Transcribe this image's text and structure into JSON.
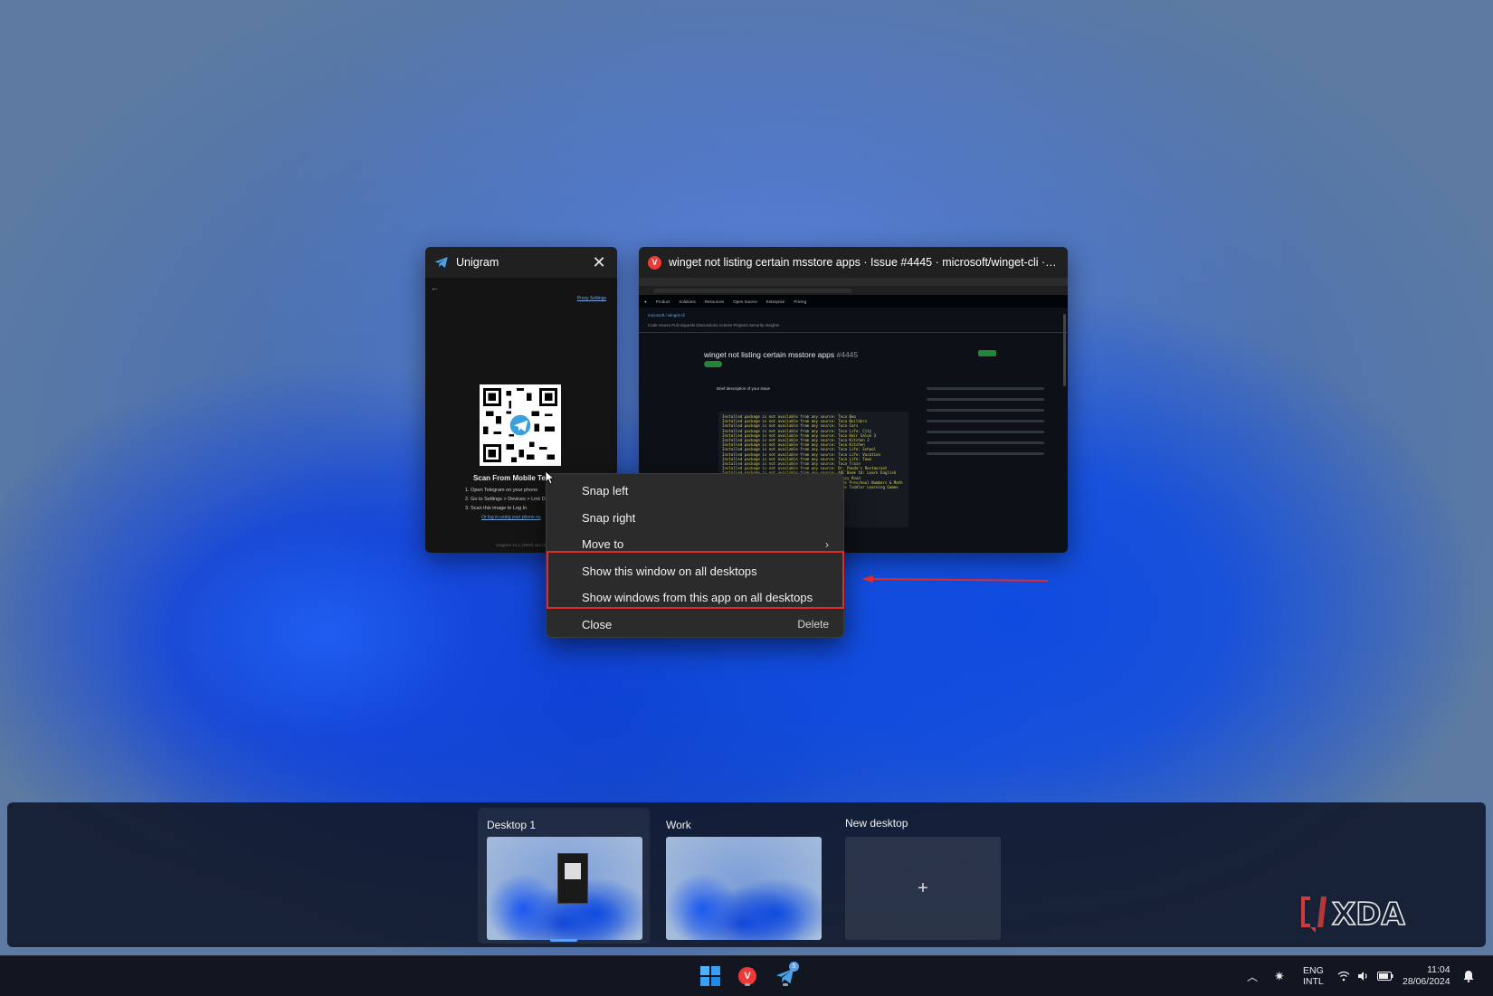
{
  "windows": {
    "unigram": {
      "title": "Unigram",
      "proxy_link": "Proxy Settings",
      "heading": "Scan From Mobile Telegram",
      "steps": [
        "1.  Open Telegram on your phone",
        "2.  Go to Settings > Devices > Link Desktop Device",
        "3.  Scan this image to Log In"
      ],
      "phone_link": "Or log in using your phone nu",
      "footer": "Unigram 10.1 (3600) x64 (S"
    },
    "github": {
      "title": "winget not listing certain msstore apps · Issue #4445 · microsoft/winget-cli · GitHub...",
      "nav": [
        "Product",
        "Solutions",
        "Resources",
        "Open Source",
        "Enterprise",
        "Pricing"
      ],
      "repo": "microsoft / winget-cli",
      "repo_tabs": "Code   Issues   Pull requests   Discussions   Actions   Projects   Security   Insights",
      "issue_title": "winget not listing certain msstore apps",
      "issue_number": "#4445",
      "comment_heading": "Brief description of your issue",
      "code_lines": [
        "Installed package is not available from any source: Toca Boo",
        "Installed package is not available from any source: Toca Builders",
        "Installed package is not available from any source: Toca Cars",
        "Installed package is not available from any source: Toca Life: City",
        "Installed package is not available from any source: Toca Hair Salon 3",
        "Installed package is not available from any source: Toca Kitchen 2",
        "Installed package is not available from any source: Toca Kitchen",
        "Installed package is not available from any source: Toca Life: School",
        "Installed package is not available from any source: Toca Life: Vacation",
        "Installed package is not available from any source: Toca Life: Town",
        "Installed package is not available from any source: Toca Train",
        "Installed package is not available from any source: Dr. Panda's Restaurant",
        "Installed package is not available from any source: ABC Book 10: Learn English",
        "Installed package is not available from any source: Crazy Road",
        "Installed package is not available from any source: Kids Preschool Numbers & Math",
        "Installed package is not available from any source: Kids Toddler Learning Games"
      ]
    }
  },
  "context_menu": {
    "items": [
      {
        "label": "Snap left"
      },
      {
        "label": "Snap right"
      },
      {
        "label": "Move to"
      },
      {
        "label": "Show this window on all desktops"
      },
      {
        "label": "Show windows from this app on all desktops"
      },
      {
        "label": "Close",
        "shortcut": "Delete"
      }
    ],
    "highlight_color": "#e02b2b"
  },
  "desktops": [
    {
      "label": "Desktop 1",
      "active": true
    },
    {
      "label": "Work"
    },
    {
      "label": "New desktop",
      "icon": "plus-icon"
    }
  ],
  "watermark": "XDA",
  "taskbar": {
    "apps": [
      {
        "name": "start",
        "icon": "windows-logo-icon"
      },
      {
        "name": "vivaldi",
        "icon": "vivaldi-icon"
      },
      {
        "name": "unigram",
        "icon": "telegram-icon",
        "badge": "5"
      }
    ],
    "lang_top": "ENG",
    "lang_bottom": "INTL",
    "time": "11:04",
    "date": "28/06/2024"
  }
}
